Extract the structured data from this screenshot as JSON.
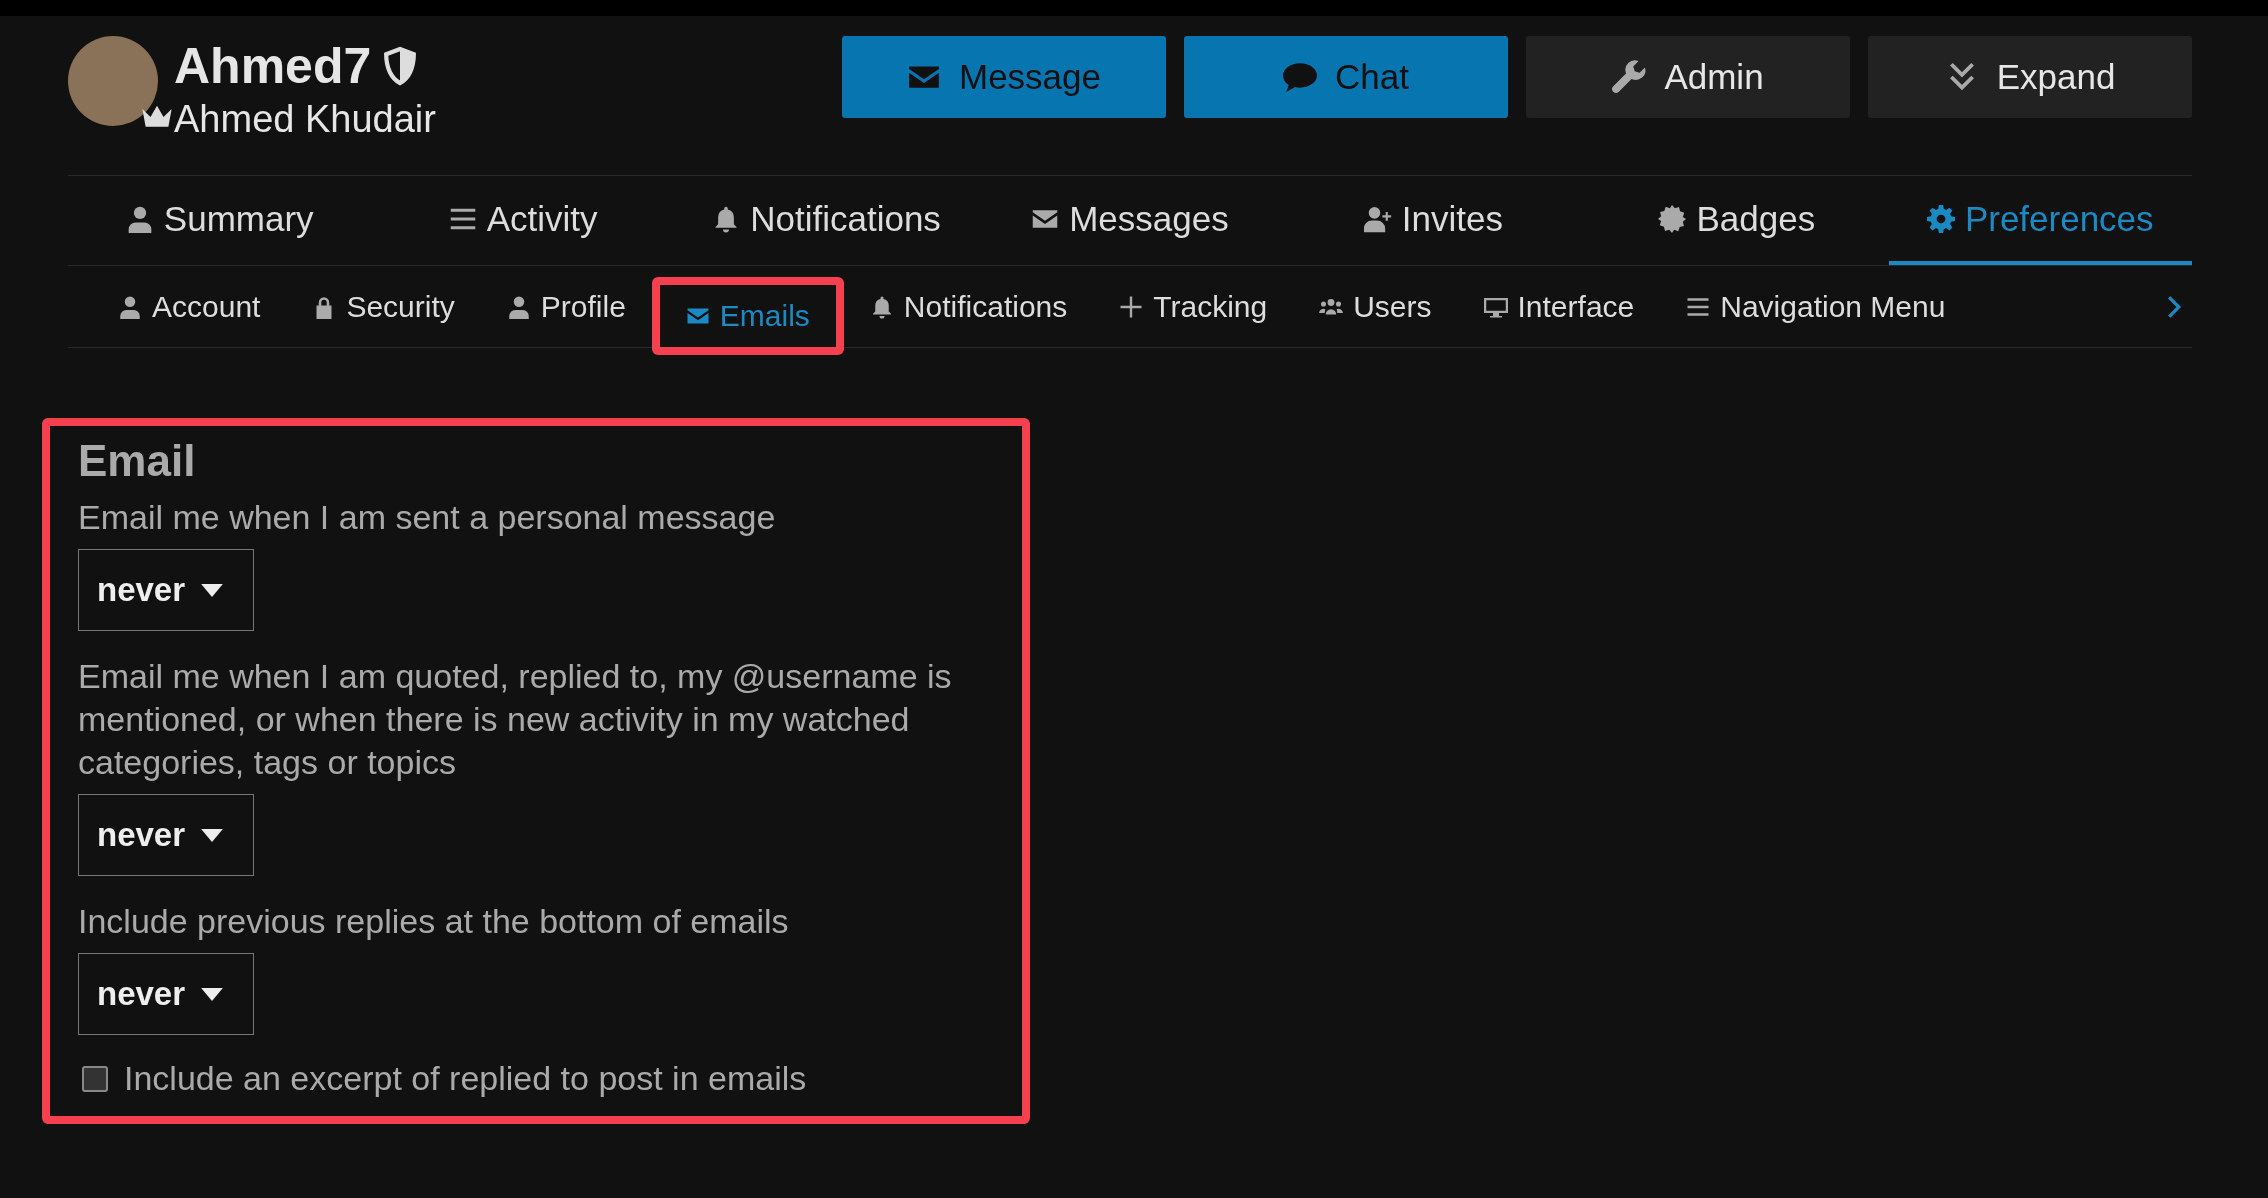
{
  "profile": {
    "username": "Ahmed7",
    "full_name": "Ahmed Khudair"
  },
  "actions": [
    {
      "label": "Message",
      "kind": "primary"
    },
    {
      "label": "Chat",
      "kind": "primary"
    },
    {
      "label": "Admin",
      "kind": "secondary"
    },
    {
      "label": "Expand",
      "kind": "secondary"
    }
  ],
  "tabs": [
    {
      "label": "Summary",
      "selected": false
    },
    {
      "label": "Activity",
      "selected": false
    },
    {
      "label": "Notifications",
      "selected": false
    },
    {
      "label": "Messages",
      "selected": false
    },
    {
      "label": "Invites",
      "selected": false
    },
    {
      "label": "Badges",
      "selected": false
    },
    {
      "label": "Preferences",
      "selected": true
    }
  ],
  "subtabs": [
    {
      "label": "Account",
      "selected": false,
      "highlighted": false
    },
    {
      "label": "Security",
      "selected": false,
      "highlighted": false
    },
    {
      "label": "Profile",
      "selected": false,
      "highlighted": false
    },
    {
      "label": "Emails",
      "selected": true,
      "highlighted": true
    },
    {
      "label": "Notifications",
      "selected": false,
      "highlighted": false
    },
    {
      "label": "Tracking",
      "selected": false,
      "highlighted": false
    },
    {
      "label": "Users",
      "selected": false,
      "highlighted": false
    },
    {
      "label": "Interface",
      "selected": false,
      "highlighted": false
    },
    {
      "label": "Navigation Menu",
      "selected": false,
      "highlighted": false
    }
  ],
  "email_section": {
    "title": "Email",
    "highlighted": true,
    "settings": [
      {
        "kind": "select",
        "label": "Email me when I am sent a personal message",
        "value": "never"
      },
      {
        "kind": "select",
        "label": "Email me when I am quoted, replied to, my @username is mentioned, or when there is new activity in my watched categories, tags or topics",
        "value": "never"
      },
      {
        "kind": "select",
        "label": "Include previous replies at the bottom of emails",
        "value": "never"
      },
      {
        "kind": "checkbox",
        "label": "Include an excerpt of replied to post in emails",
        "checked": false
      }
    ]
  }
}
